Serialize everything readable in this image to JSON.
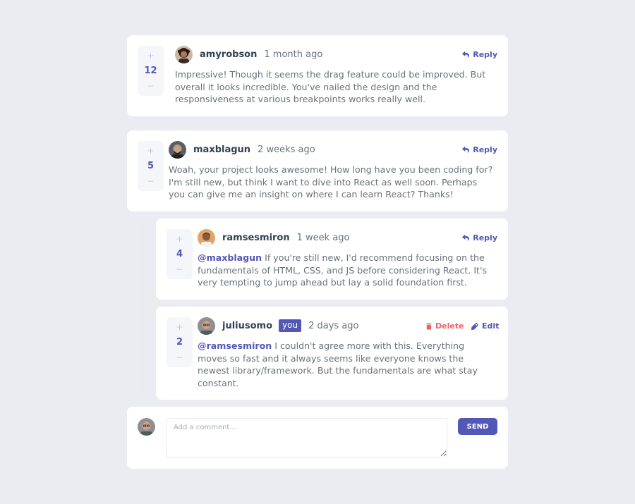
{
  "comments": [
    {
      "score": "12",
      "user": "amyrobson",
      "time": "1 month ago",
      "action": "Reply",
      "text": "Impressive! Though it seems the drag feature could be improved. But overall it looks incredible. You've nailed the design and the responsiveness at various breakpoints works really well."
    },
    {
      "score": "5",
      "user": "maxblagun",
      "time": "2 weeks ago",
      "action": "Reply",
      "text": "Woah, your project looks awesome! How long have you been coding for? I'm still new, but think I want to dive into React as well soon. Perhaps you can give me an insight on where I can learn React? Thanks!"
    }
  ],
  "replies": [
    {
      "score": "4",
      "user": "ramsesmiron",
      "time": "1 week ago",
      "action": "Reply",
      "mention": "@maxblagun",
      "text": "If you're still new, I'd recommend focusing on the fundamentals of HTML, CSS, and JS before considering React. It's very tempting to jump ahead but lay a solid foundation first."
    },
    {
      "score": "2",
      "user": "juliusomo",
      "you_badge": "you",
      "time": "2 days ago",
      "delete_label": "Delete",
      "edit_label": "Edit",
      "mention": "@ramsesmiron",
      "text": "I couldn't agree more with this. Everything moves so fast and it always seems like everyone knows the newest library/framework. But the fundamentals are what stay constant."
    }
  ],
  "composer": {
    "placeholder": "Add a comment...",
    "send_label": "SEND"
  },
  "vote": {
    "plus": "+",
    "minus": "−"
  },
  "colors": {
    "primary": "#5357b6",
    "danger": "#ed6368",
    "background": "#eaecf1",
    "username": "#334253",
    "body_text": "#67727e",
    "vote_muted": "#c5c6ef"
  },
  "icons": {
    "reply": "reply-icon",
    "delete": "trash-icon",
    "edit": "pencil-icon"
  }
}
